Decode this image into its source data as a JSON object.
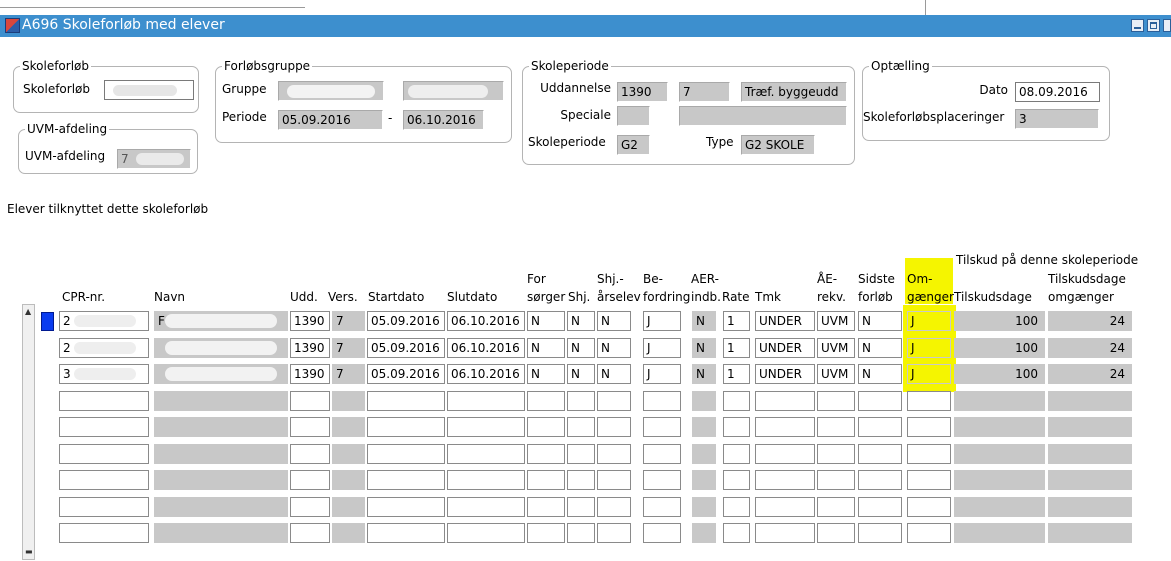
{
  "window": {
    "title": "A696 Skoleforløb med elever"
  },
  "skoleforloeb_group": {
    "legend": "Skoleforløb",
    "label": "Skoleforløb",
    "value": ""
  },
  "uvm_group": {
    "legend": "UVM-afdeling",
    "label": "UVM-afdeling",
    "value": "7"
  },
  "forloebsgruppe": {
    "legend": "Forløbsgruppe",
    "gruppe_label": "Gruppe",
    "gruppe_value": "",
    "gruppe_value2": "",
    "periode_label": "Periode",
    "periode_from": "05.09.2016",
    "separator": "-",
    "periode_to": "06.10.2016"
  },
  "skoleperiode": {
    "legend": "Skoleperiode",
    "uddannelse_label": "Uddannelse",
    "uddannelse_value": "1390",
    "uddannelse_version": "7",
    "uddannelse_text": "Træf. byggeudd",
    "speciale_label": "Speciale",
    "skoleperiode_label": "Skoleperiode",
    "skoleperiode_value": "G2",
    "type_label": "Type",
    "type_value": "G2 SKOLE"
  },
  "optaelling": {
    "legend": "Optælling",
    "dato_label": "Dato",
    "dato_value": "08.09.2016",
    "placeringer_label": "Skoleforløbsplaceringer",
    "placeringer_value": "3"
  },
  "section_title": "Elever tilknyttet dette skoleforløb",
  "tilskud_heading": "Tilskud på denne skoleperiode",
  "columns": {
    "cpr": "CPR-nr.",
    "navn": "Navn",
    "udd": "Udd.",
    "vers": "Vers.",
    "startdato": "Startdato",
    "slutdato": "Slutdato",
    "forsorger_1": "For",
    "forsorger_2": "sørger",
    "shj": "Shj.",
    "shj_aarselev_1": "Shj.-",
    "shj_aarselev_2": "årselev",
    "befordring_1": "Be-",
    "befordring_2": "fordring",
    "aer_1": "AER-",
    "aer_2": "indb.",
    "rate": "Rate",
    "tmk": "Tmk",
    "ae_rekv_1": "ÅE-",
    "ae_rekv_2": "rekv.",
    "sidste_1": "Sidste",
    "sidste_2": "forløb",
    "omgaenger_1": "Om-",
    "omgaenger_2": "gænger",
    "tilskudsdage": "Tilskudsdage",
    "tilskudsdage_omg_1": "Tilskudsdage",
    "tilskudsdage_omg_2": "omgænger"
  },
  "rows": [
    {
      "cpr": "2",
      "navn": "F",
      "udd": "1390",
      "vers": "7",
      "startdato": "05.09.2016",
      "slutdato": "06.10.2016",
      "forsorger": "N",
      "shj": "N",
      "shj_aarselev": "N",
      "befordring": "J",
      "aer": "N",
      "rate": "1",
      "tmk": "UNDER",
      "ae_rekv": "UVM",
      "sidste": "N",
      "omgaenger": "J",
      "tilskudsdage": "100",
      "tilskudsdage_omg": "24"
    },
    {
      "cpr": "2",
      "navn": "",
      "udd": "1390",
      "vers": "7",
      "startdato": "05.09.2016",
      "slutdato": "06.10.2016",
      "forsorger": "N",
      "shj": "N",
      "shj_aarselev": "N",
      "befordring": "J",
      "aer": "N",
      "rate": "1",
      "tmk": "UNDER",
      "ae_rekv": "UVM",
      "sidste": "N",
      "omgaenger": "J",
      "tilskudsdage": "100",
      "tilskudsdage_omg": "24"
    },
    {
      "cpr": "3",
      "navn": "",
      "udd": "1390",
      "vers": "7",
      "startdato": "05.09.2016",
      "slutdato": "06.10.2016",
      "forsorger": "N",
      "shj": "N",
      "shj_aarselev": "N",
      "befordring": "J",
      "aer": "N",
      "rate": "1",
      "tmk": "UNDER",
      "ae_rekv": "UVM",
      "sidste": "N",
      "omgaenger": "J",
      "tilskudsdage": "100",
      "tilskudsdage_omg": "24"
    }
  ],
  "colors": {
    "titlebar": "#3d8fce",
    "highlight": "#f5f500",
    "readonly_field": "#c8c8c8",
    "record_indicator": "#0a3cf0"
  }
}
